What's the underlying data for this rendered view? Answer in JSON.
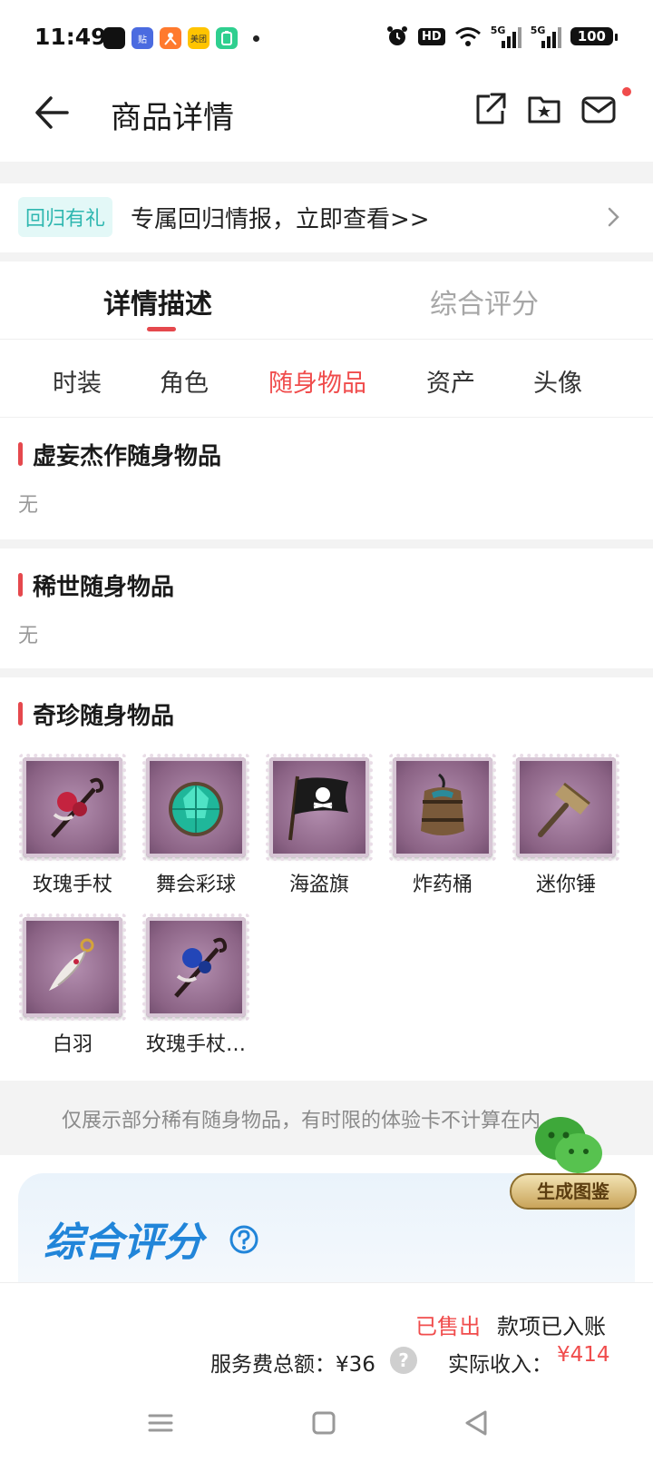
{
  "status_bar": {
    "time": "11:49",
    "apps": [
      {
        "icon": "app-black-icon",
        "color": "#111111",
        "text": ""
      },
      {
        "icon": "tieba-icon",
        "color": "#4b6be0",
        "text": "贴"
      },
      {
        "icon": "person-app-icon",
        "color": "#ff7a2e",
        "text": ""
      },
      {
        "icon": "meituan-icon",
        "color": "#ffc400",
        "text": "美团"
      },
      {
        "icon": "battery-app-icon",
        "color": "#2fcf8f",
        "text": ""
      }
    ],
    "hd_label": "HD",
    "signal_label": "5G",
    "battery": "100"
  },
  "nav": {
    "title": "商品详情"
  },
  "promo": {
    "badge": "回归有礼",
    "text": "专属回归情报，立即查看>>"
  },
  "main_tabs": [
    {
      "label": "详情描述",
      "active": true
    },
    {
      "label": "综合评分",
      "active": false
    }
  ],
  "sub_tabs": [
    {
      "label": "时装",
      "active": false
    },
    {
      "label": "角色",
      "active": false
    },
    {
      "label": "随身物品",
      "active": true
    },
    {
      "label": "资产",
      "active": false
    },
    {
      "label": "头像",
      "active": false
    }
  ],
  "sections": {
    "masterpiece": {
      "title": "虚妄杰作随身物品",
      "value": "无"
    },
    "rare": {
      "title": "稀世随身物品",
      "value": "无"
    },
    "treasure": {
      "title": "奇珍随身物品",
      "items": [
        {
          "label": "玫瑰手杖",
          "icon": "rose-cane-icon"
        },
        {
          "label": "舞会彩球",
          "icon": "ball-gem-icon"
        },
        {
          "label": "海盗旗",
          "icon": "pirate-flag-icon"
        },
        {
          "label": "炸药桶",
          "icon": "powder-keg-icon"
        },
        {
          "label": "迷你锤",
          "icon": "mini-hammer-icon"
        },
        {
          "label": "白羽",
          "icon": "white-feather-icon"
        },
        {
          "label": "玫瑰手杖…",
          "icon": "blue-rose-cane-icon"
        }
      ]
    }
  },
  "notice": "仅展示部分稀有随身物品，有时限的体验卡不计算在内",
  "floating_widget": {
    "label": "生成图鉴"
  },
  "rating": {
    "title": "综合评分"
  },
  "bottom": {
    "status_sold": "已售出",
    "status_received": "款项已入账",
    "fee_label": "服务费总额：¥36",
    "fee_help": "?",
    "income_label": "实际收入：",
    "income_value": "¥414"
  },
  "colors": {
    "accent_red": "#e5484d",
    "teal_badge": "#2fb7b0",
    "rating_blue": "#2185d9"
  }
}
